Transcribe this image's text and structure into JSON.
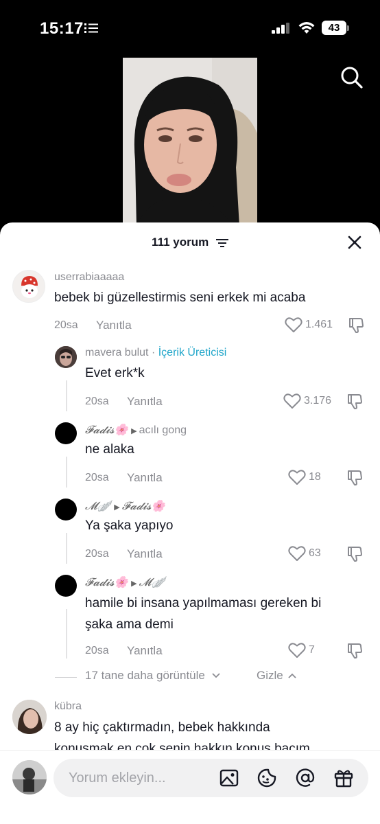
{
  "status_bar": {
    "time": "15:17",
    "battery": "43"
  },
  "header": {
    "comment_count_label": "111 yorum"
  },
  "comments": [
    {
      "username": "userrabiaaaaa",
      "text": "bebek bi güzellestirmis seni erkek mi acaba",
      "time": "20sa",
      "reply_label": "Yanıtla",
      "likes": "1.461"
    },
    {
      "username": "mavera bulut",
      "badge": "İçerik Üreticisi",
      "text": "Evet erk*k",
      "time": "20sa",
      "reply_label": "Yanıtla",
      "likes": "3.176"
    },
    {
      "username": "𝓕𝓪𝓭𝓲𝓼🌸",
      "reply_to": "acılı gong",
      "text": "ne alaka",
      "time": "20sa",
      "reply_label": "Yanıtla",
      "likes": "18"
    },
    {
      "username": "𝓜🪽",
      "reply_to": "𝓕𝓪𝓭𝓲𝓼🌸",
      "text": "Ya şaka yapıyo",
      "time": "20sa",
      "reply_label": "Yanıtla",
      "likes": "63"
    },
    {
      "username": "𝓕𝓪𝓭𝓲𝓼🌸",
      "reply_to": "𝓜🪽",
      "text_line1": "hamile bi insana yapılmaması gereken bi",
      "text_line2": "şaka ama demi",
      "time": "20sa",
      "reply_label": "Yanıtla",
      "likes": "7"
    },
    {
      "username": "kübra",
      "text_line1": "8 ay hiç çaktırmadın, bebek hakkında",
      "text_line2": "konusmak en çok senin hakkın konuş bacım"
    }
  ],
  "replies_controls": {
    "view_more": "17 tane daha görüntüle",
    "hide": "Gizle"
  },
  "input": {
    "placeholder": "Yorum ekleyin..."
  },
  "icons": [
    "list-icon",
    "search-icon",
    "filter-icon",
    "close-icon",
    "heart-icon",
    "dislike-icon",
    "image-icon",
    "emoji-icon",
    "mention-icon",
    "gift-icon"
  ]
}
